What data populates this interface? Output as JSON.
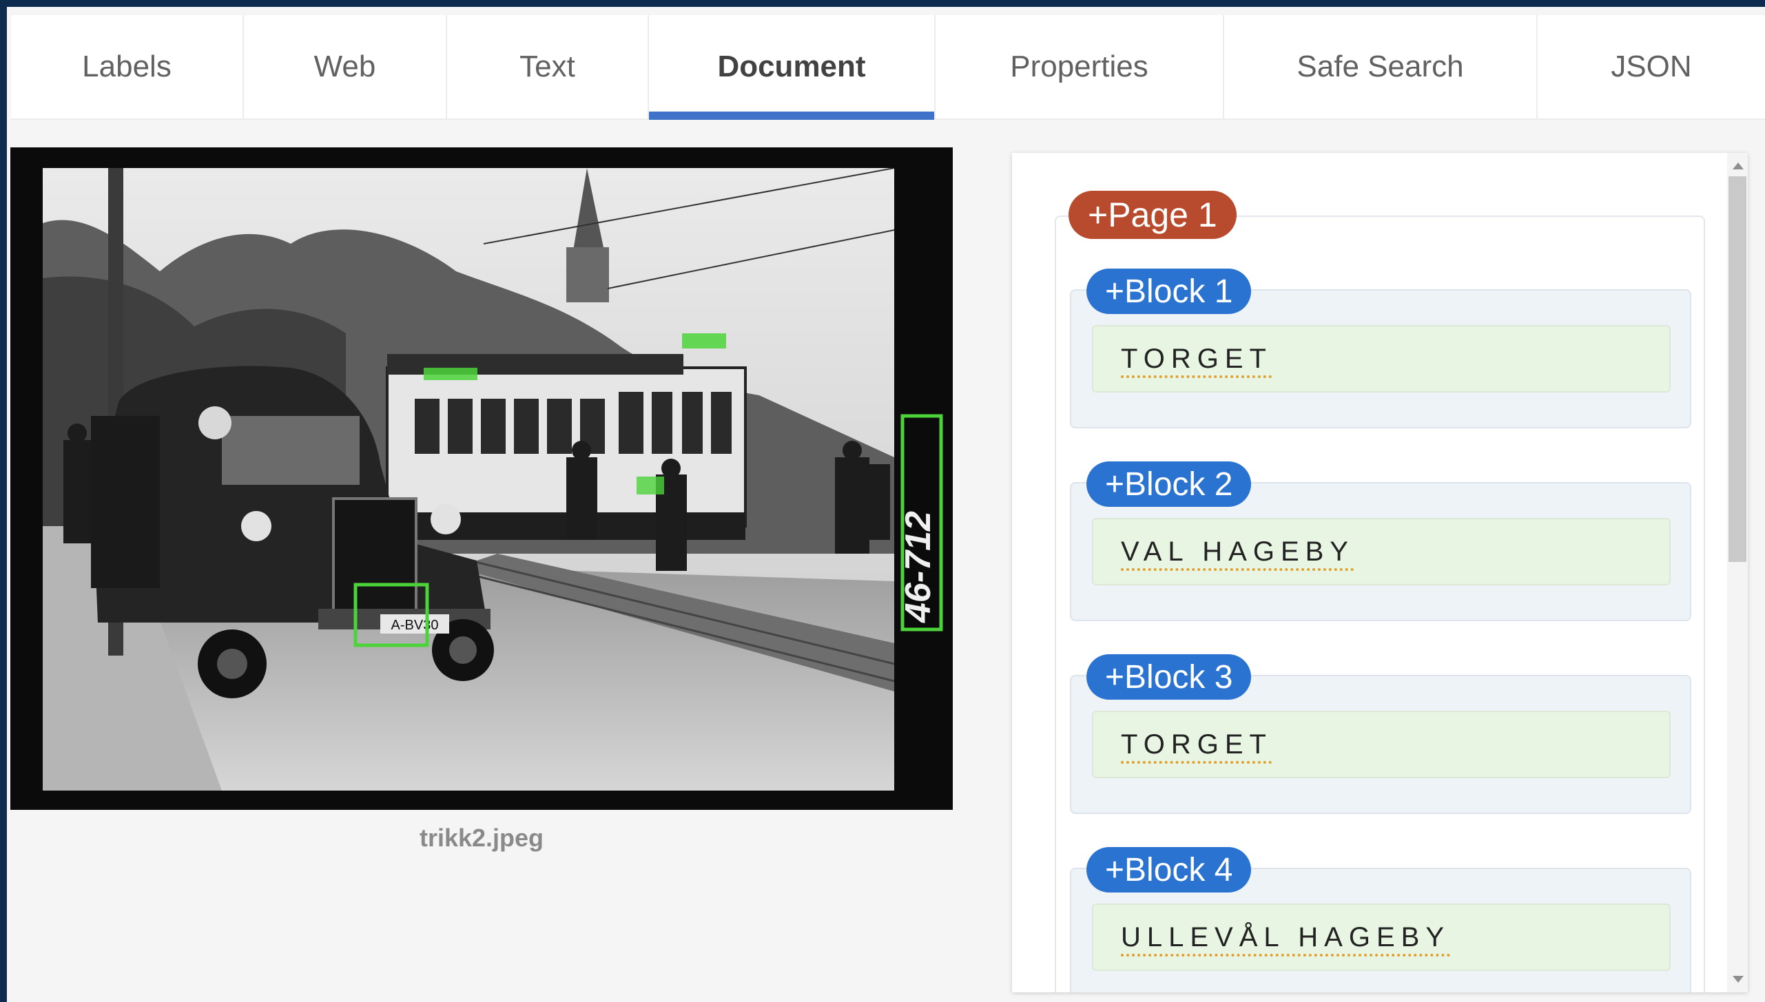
{
  "tabs": [
    {
      "label": "Labels"
    },
    {
      "label": "Web"
    },
    {
      "label": "Text"
    },
    {
      "label": "Document"
    },
    {
      "label": "Properties"
    },
    {
      "label": "Safe Search"
    },
    {
      "label": "JSON"
    }
  ],
  "active_tab": "Document",
  "image": {
    "caption": "trikk2.jpeg",
    "plate_text": "A-BV30",
    "side_text": "46-712"
  },
  "document": {
    "page_label": "+Page 1",
    "blocks": [
      {
        "label": "+Block 1",
        "text": "TORGET"
      },
      {
        "label": "+Block 2",
        "text": "VAL HAGEBY"
      },
      {
        "label": "+Block 3",
        "text": "TORGET"
      },
      {
        "label": "+Block 4",
        "text": "ULLEVÅL HAGEBY"
      }
    ]
  },
  "colors": {
    "accent": "#3f72c9",
    "page_badge": "#b84a2e",
    "block_badge": "#2b73d0",
    "detection_box": "#4cd33a"
  }
}
